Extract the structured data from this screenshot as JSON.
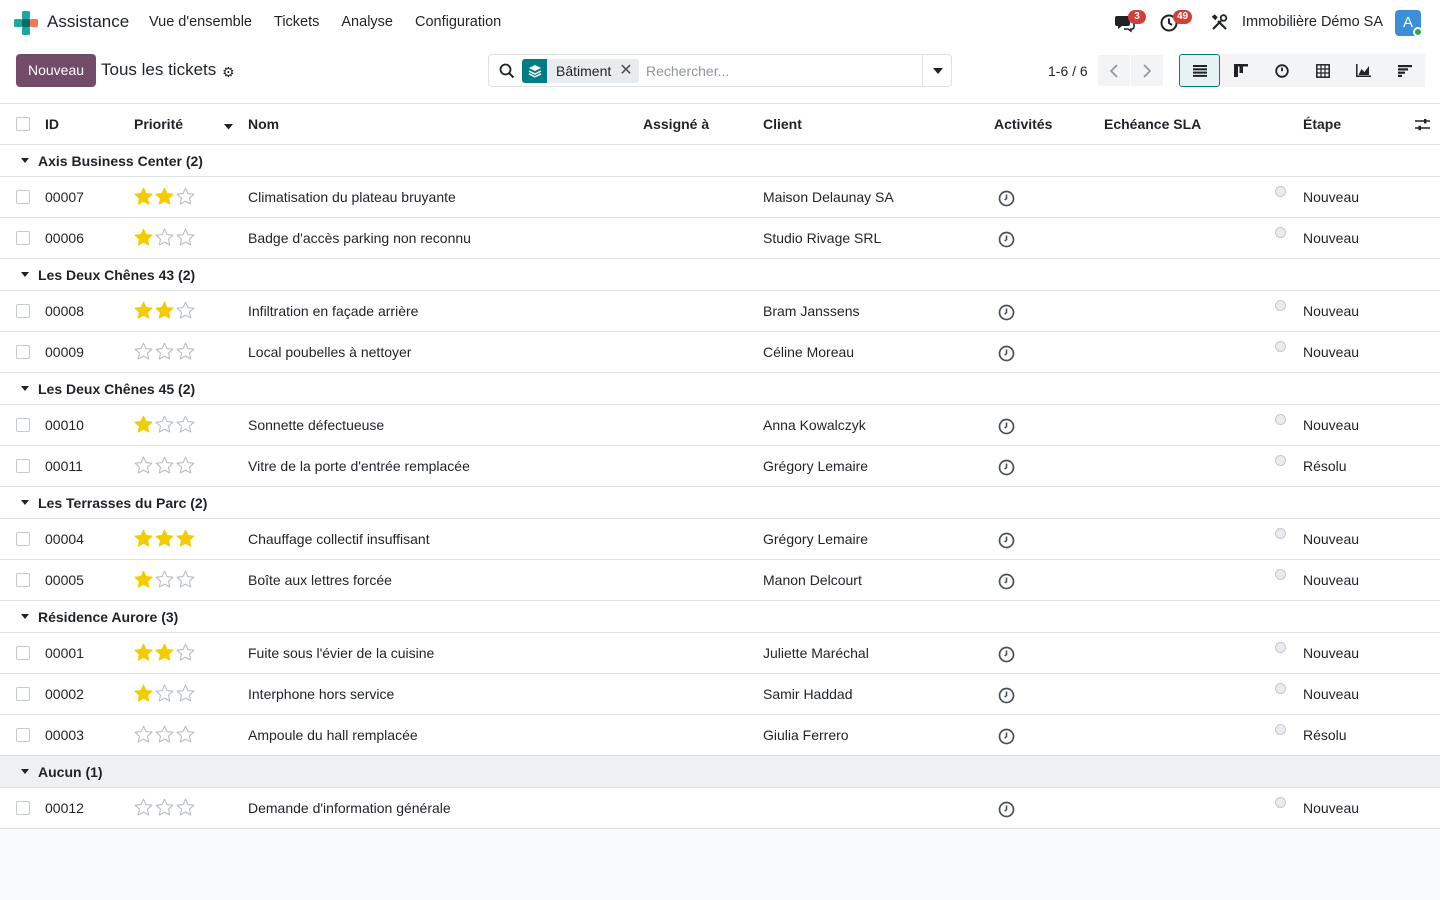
{
  "navbar": {
    "app_name": "Assistance",
    "menu": [
      "Vue d'ensemble",
      "Tickets",
      "Analyse",
      "Configuration"
    ],
    "messages_count": "3",
    "activities_count": "49",
    "company": "Immobilière Démo SA",
    "avatar_letter": "A"
  },
  "control": {
    "new_label": "Nouveau",
    "title": "Tous les tickets",
    "facet_value": "Bâtiment",
    "search_placeholder": "Rechercher...",
    "pager": "1-6 / 6"
  },
  "table": {
    "headers": {
      "id": "ID",
      "priority": "Priorité",
      "name": "Nom",
      "assigned": "Assigné à",
      "client": "Client",
      "activities": "Activités",
      "sla": "Echéance SLA",
      "stage": "Étape"
    },
    "groups": [
      {
        "label": "Axis Business Center (2)",
        "rows": [
          {
            "id": "00007",
            "stars": 2,
            "name": "Climatisation du plateau bruyante",
            "client": "Maison Delaunay SA",
            "stage": "Nouveau"
          },
          {
            "id": "00006",
            "stars": 1,
            "name": "Badge d'accès parking non reconnu",
            "client": "Studio Rivage SRL",
            "stage": "Nouveau"
          }
        ]
      },
      {
        "label": "Les Deux Chênes 43 (2)",
        "rows": [
          {
            "id": "00008",
            "stars": 2,
            "name": "Infiltration en façade arrière",
            "client": "Bram Janssens",
            "stage": "Nouveau"
          },
          {
            "id": "00009",
            "stars": 0,
            "name": "Local poubelles à nettoyer",
            "client": "Céline Moreau",
            "stage": "Nouveau"
          }
        ]
      },
      {
        "label": "Les Deux Chênes 45 (2)",
        "rows": [
          {
            "id": "00010",
            "stars": 1,
            "name": "Sonnette défectueuse",
            "client": "Anna Kowalczyk",
            "stage": "Nouveau"
          },
          {
            "id": "00011",
            "stars": 0,
            "name": "Vitre de la porte d'entrée remplacée",
            "client": "Grégory Lemaire",
            "stage": "Résolu"
          }
        ]
      },
      {
        "label": "Les Terrasses du Parc (2)",
        "rows": [
          {
            "id": "00004",
            "stars": 3,
            "name": "Chauffage collectif insuffisant",
            "client": "Grégory Lemaire",
            "stage": "Nouveau"
          },
          {
            "id": "00005",
            "stars": 1,
            "name": "Boîte aux lettres forcée",
            "client": "Manon Delcourt",
            "stage": "Nouveau"
          }
        ]
      },
      {
        "label": "Résidence Aurore (3)",
        "rows": [
          {
            "id": "00001",
            "stars": 2,
            "name": "Fuite sous l'évier de la cuisine",
            "client": "Juliette Maréchal",
            "stage": "Nouveau"
          },
          {
            "id": "00002",
            "stars": 1,
            "name": "Interphone hors service",
            "client": "Samir Haddad",
            "stage": "Nouveau"
          },
          {
            "id": "00003",
            "stars": 0,
            "name": "Ampoule du hall remplacée",
            "client": "Giulia Ferrero",
            "stage": "Résolu"
          }
        ]
      },
      {
        "label": "Aucun (1)",
        "rows": [
          {
            "id": "00012",
            "stars": 0,
            "name": "Demande d'information générale",
            "client": "",
            "stage": "Nouveau"
          }
        ]
      }
    ]
  },
  "colors": {
    "primary": "#714b67",
    "accent": "#017e84",
    "star": "#f3cc00",
    "badge": "#d23f3a"
  }
}
